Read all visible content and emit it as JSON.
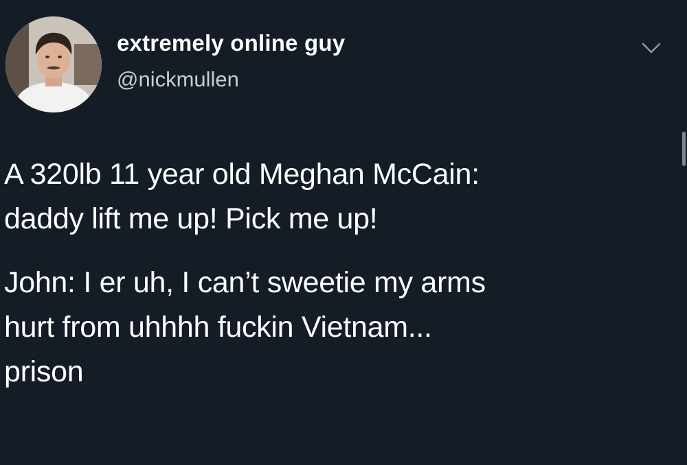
{
  "tweet": {
    "display_name": "extremely online guy",
    "handle": "@nickmullen",
    "paragraphs": [
      "A 320lb 11 year old Meghan McCain:\ndaddy lift me up! Pick me up!",
      "John: I er uh, I can’t sweetie my arms\nhurt from uhhhh fuckin Vietnam...\nprison"
    ]
  },
  "icons": {
    "menu": "chevron-down-icon"
  },
  "colors": {
    "background": "#141d26",
    "text": "#ffffff",
    "secondary_text": "#c7ccd1"
  }
}
